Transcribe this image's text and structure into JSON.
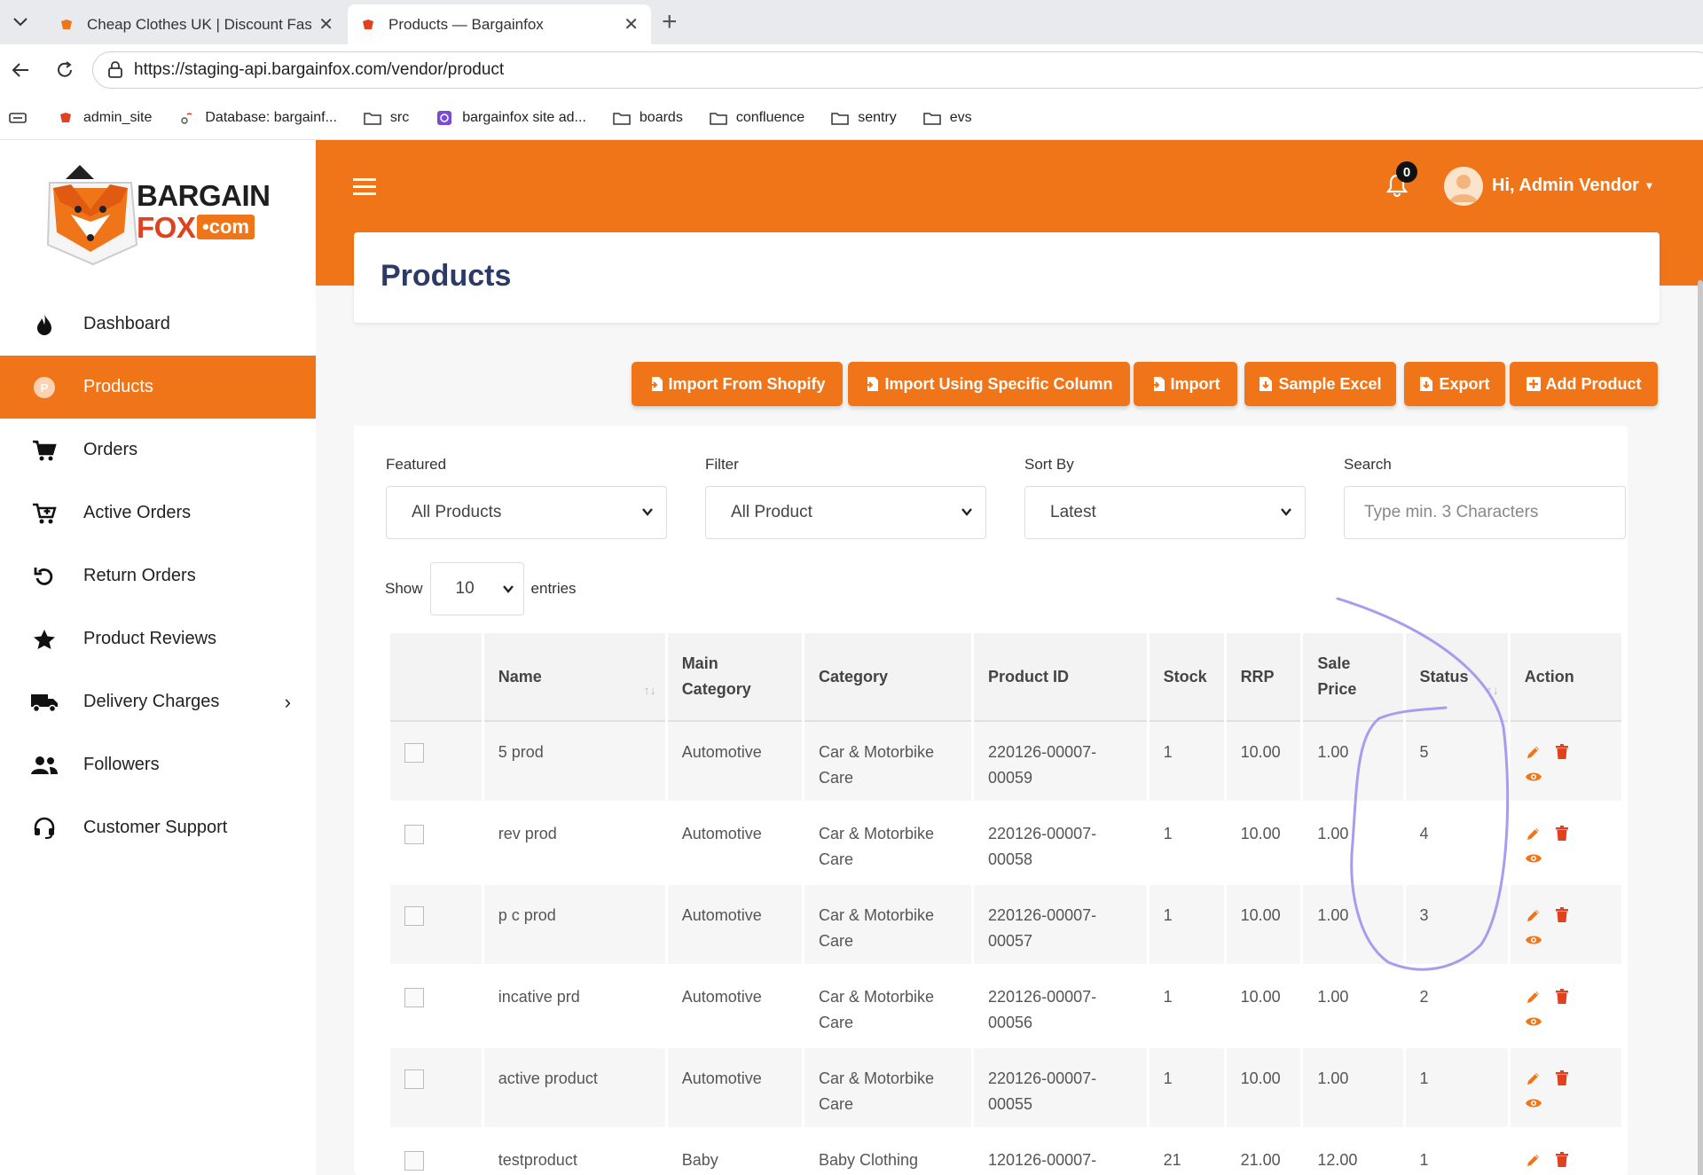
{
  "browser": {
    "tabs": [
      {
        "title": "Cheap Clothes UK | Discount Fashi",
        "active": false
      },
      {
        "title": "Products — Bargainfox",
        "active": true
      }
    ],
    "url": "https://staging-api.bargainfox.com/vendor/product",
    "bookmarks": [
      "admin_site",
      "Database: bargainf...",
      "src",
      "bargainfox site ad...",
      "boards",
      "confluence",
      "sentry",
      "evs"
    ]
  },
  "brand": {
    "line1": "BARGAIN",
    "line2": "FOX",
    "line3": "•com",
    "accent": "#f07519"
  },
  "sidebar": {
    "items": [
      {
        "label": "Dashboard",
        "icon": "fire-icon"
      },
      {
        "label": "Products",
        "icon": "product-icon",
        "active": true
      },
      {
        "label": "Orders",
        "icon": "cart-icon"
      },
      {
        "label": "Active Orders",
        "icon": "cart-plus-icon"
      },
      {
        "label": "Return Orders",
        "icon": "undo-icon"
      },
      {
        "label": "Product Reviews",
        "icon": "star-icon"
      },
      {
        "label": "Delivery Charges",
        "icon": "truck-icon",
        "has_children": true
      },
      {
        "label": "Followers",
        "icon": "users-icon"
      },
      {
        "label": "Customer Support",
        "icon": "headset-icon"
      }
    ]
  },
  "header": {
    "notifications": "0",
    "user": "Hi, Admin Vendor"
  },
  "page": {
    "title": "Products"
  },
  "actions": {
    "import_shopify": "Import From Shopify",
    "import_column": "Import Using Specific Column",
    "import": "Import",
    "sample_excel": "Sample Excel",
    "export": "Export",
    "add_product": "Add Product"
  },
  "filters": {
    "featured": {
      "label": "Featured",
      "value": "All Products"
    },
    "filter": {
      "label": "Filter",
      "value": "All Product"
    },
    "sort": {
      "label": "Sort By",
      "value": "Latest"
    },
    "search": {
      "label": "Search",
      "placeholder": "Type min. 3 Characters"
    }
  },
  "entries": {
    "show": "Show",
    "value": "10",
    "suffix": "entries"
  },
  "table": {
    "headers": [
      "",
      "Name",
      "Main Category",
      "Category",
      "Product ID",
      "Stock",
      "RRP",
      "Sale Price",
      "Status",
      "Action"
    ],
    "rows": [
      {
        "name": "5 prod",
        "main_category": "Automotive",
        "category": "Car & Motorbike Care",
        "product_id": "220126-00007-00059",
        "stock": "1",
        "rrp": "10.00",
        "sale_price": "1.00",
        "status": "5"
      },
      {
        "name": "rev prod",
        "main_category": "Automotive",
        "category": "Car & Motorbike Care",
        "product_id": "220126-00007-00058",
        "stock": "1",
        "rrp": "10.00",
        "sale_price": "1.00",
        "status": "4"
      },
      {
        "name": "p c prod",
        "main_category": "Automotive",
        "category": "Car & Motorbike Care",
        "product_id": "220126-00007-00057",
        "stock": "1",
        "rrp": "10.00",
        "sale_price": "1.00",
        "status": "3"
      },
      {
        "name": "incative prd",
        "main_category": "Automotive",
        "category": "Car & Motorbike Care",
        "product_id": "220126-00007-00056",
        "stock": "1",
        "rrp": "10.00",
        "sale_price": "1.00",
        "status": "2"
      },
      {
        "name": "active product",
        "main_category": "Automotive",
        "category": "Car & Motorbike Care",
        "product_id": "220126-00007-00055",
        "stock": "1",
        "rrp": "10.00",
        "sale_price": "1.00",
        "status": "1"
      },
      {
        "name": "testproduct",
        "main_category": "Baby",
        "category": "Baby Clothing",
        "product_id": "120126-00007-",
        "stock": "21",
        "rrp": "21.00",
        "sale_price": "12.00",
        "status": "1"
      }
    ]
  }
}
